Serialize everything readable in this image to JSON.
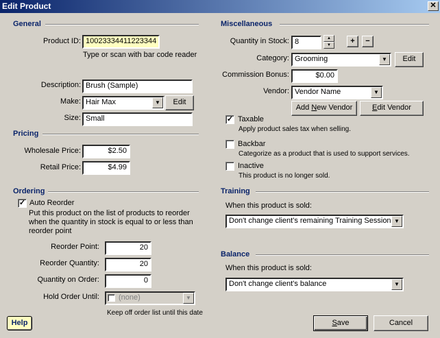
{
  "window": {
    "title": "Edit Product",
    "close_glyph": "✕"
  },
  "general": {
    "heading": "General",
    "product_id_label": "Product ID:",
    "product_id_value": "10023334411223344",
    "product_id_hint": "Type or scan with bar code reader",
    "description_label": "Description:",
    "description_value": "Brush (Sample)",
    "make_label": "Make:",
    "make_value": "Hair Max",
    "make_edit_button": "Edit",
    "size_label": "Size:",
    "size_value": "Small"
  },
  "pricing": {
    "heading": "Pricing",
    "wholesale_label": "Wholesale Price:",
    "wholesale_value": "$2.50",
    "retail_label": "Retail Price:",
    "retail_value": "$4.99"
  },
  "ordering": {
    "heading": "Ordering",
    "auto_reorder_label": "Auto Reorder",
    "auto_reorder_checked": true,
    "auto_reorder_desc_1": "Put this product on the list of products to reorder",
    "auto_reorder_desc_2": "when the quantity in stock is equal to or less than",
    "auto_reorder_desc_3": "reorder point",
    "reorder_point_label": "Reorder Point:",
    "reorder_point_value": "20",
    "reorder_qty_label": "Reorder Quantity:",
    "reorder_qty_value": "20",
    "qty_on_order_label": "Quantity on Order:",
    "qty_on_order_value": "0",
    "hold_until_label": "Hold Order Until:",
    "hold_until_value": "(none)",
    "hold_until_hint": "Keep off order list until this date"
  },
  "misc": {
    "heading": "Miscellaneous",
    "qty_stock_label": "Quantity in Stock:",
    "qty_stock_value": "8",
    "plus_button": "+",
    "minus_button": "−",
    "category_label": "Category:",
    "category_value": "Grooming",
    "category_edit_button": "Edit",
    "commission_label": "Commission Bonus:",
    "commission_value": "$0.00",
    "vendor_label": "Vendor:",
    "vendor_value": "Vendor Name",
    "add_vendor_button_pre": "Add ",
    "add_vendor_button_u": "N",
    "add_vendor_button_post": "ew Vendor",
    "edit_vendor_button_u": "E",
    "edit_vendor_button_post": "dit Vendor",
    "taxable_label": "Taxable",
    "taxable_checked": true,
    "taxable_desc": "Apply product sales tax when selling.",
    "backbar_label": "Backbar",
    "backbar_checked": false,
    "backbar_desc": "Categorize as a product that is used to support services.",
    "inactive_label": "Inactive",
    "inactive_checked": false,
    "inactive_desc": "This product is no longer sold."
  },
  "training": {
    "heading": "Training",
    "when_label": "When this product is sold:",
    "option_value": "Don't change client's remaining Training Sessions"
  },
  "balance": {
    "heading": "Balance",
    "when_label": "When this product is sold:",
    "option_value": "Don't change client's balance"
  },
  "footer": {
    "help_button": "Help",
    "save_button_u": "S",
    "save_button_post": "ave",
    "cancel_button": "Cancel"
  },
  "glyphs": {
    "dropdown": "▼",
    "check": "✓",
    "spin_up": "▲",
    "spin_down": "▼"
  },
  "icons": {
    "close": "close-icon",
    "dropdown": "chevron-down-icon",
    "check": "checkmark-icon",
    "spin_up": "spin-up-icon",
    "spin_down": "spin-down-icon"
  }
}
